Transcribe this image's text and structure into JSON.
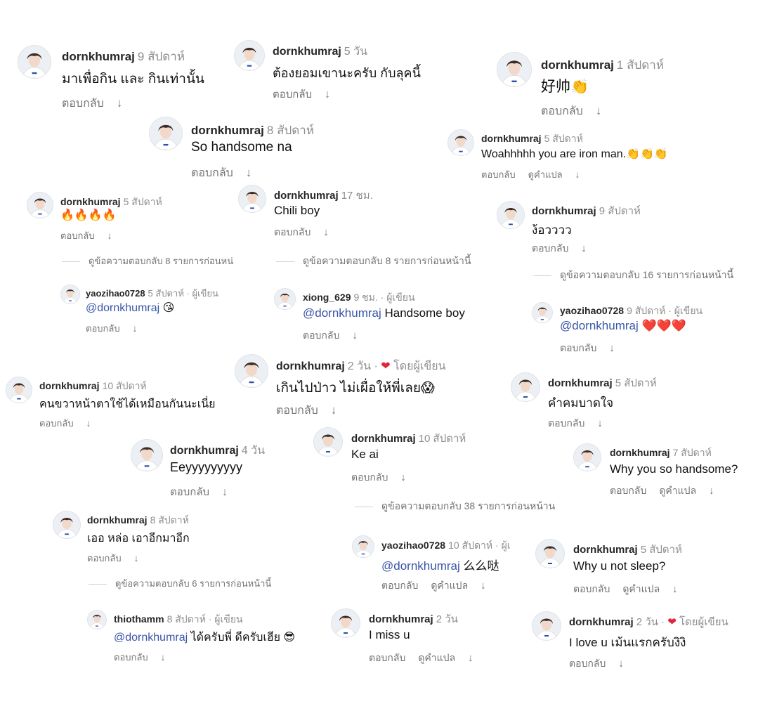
{
  "reply_label": "ตอบกลับ",
  "translate_label": "ดูคำแปล",
  "comments": [
    {
      "user": "dornkhumraj",
      "time": "9 สัปดาห์",
      "text": "มาเพื่อกิน และ กินเท่านั้น"
    },
    {
      "user": "dornkhumraj",
      "time": "5 วัน",
      "text": "ต้องยอมเขานะครับ กับลุคนี้"
    },
    {
      "user": "dornkhumraj",
      "time": "1 สัปดาห์",
      "text": "好帅👏"
    },
    {
      "user": "dornkhumraj",
      "time": "8 สัปดาห์",
      "text": "So handsome na"
    },
    {
      "user": "dornkhumraj",
      "time": "5 สัปดาห์",
      "text": "Woahhhhh you are iron man.👏👏👏"
    },
    {
      "user": "dornkhumraj",
      "time": "5 สัปดาห์",
      "text": "🔥🔥🔥🔥"
    },
    {
      "user": "dornkhumraj",
      "time": "17 ชม.",
      "text": "Chili boy"
    },
    {
      "user": "dornkhumraj",
      "time": "9 สัปดาห์",
      "text": "ง้อวววว"
    },
    {
      "user": "yaozihao0728",
      "time": "5 สัปดาห์ · ผู้เขียน",
      "mention": "@dornkhumraj",
      "text": " 😘"
    },
    {
      "user": "xiong_629",
      "time": "9 ชม. · ผู้เขียน",
      "mention": "@dornkhumraj",
      "text": " Handsome boy"
    },
    {
      "user": "yaozihao0728",
      "time": "9 สัปดาห์ · ผู้เขียน",
      "mention": "@dornkhumraj",
      "text": " ❤️❤️❤️"
    },
    {
      "user": "dornkhumraj",
      "time": "2 วัน ·",
      "heart": "❤",
      "suffix": "โดยผู้เขียน",
      "text": "เกินไปป่าว ไม่เผื่อให้พี่เลย😱"
    },
    {
      "user": "dornkhumraj",
      "time": "10 สัปดาห์",
      "text": "คนขวาหน้าตาใช้ได้เหมือนกันนะเนี่ย"
    },
    {
      "user": "dornkhumraj",
      "time": "5 สัปดาห์",
      "text": "คำคมบาดใจ"
    },
    {
      "user": "dornkhumraj",
      "time": "4 วัน",
      "text": "Eeyyyyyyyyy"
    },
    {
      "user": "dornkhumraj",
      "time": "10 สัปดาห์",
      "text": "Ke ai"
    },
    {
      "user": "dornkhumraj",
      "time": "7 สัปดาห์",
      "text": "Why you so handsome?"
    },
    {
      "user": "dornkhumraj",
      "time": "8 สัปดาห์",
      "text": "เออ หล่อ เอาอีกมาอีก"
    },
    {
      "user": "yaozihao0728",
      "time": "10 สัปดาห์ · ผู้เ",
      "mention": "@dornkhumraj",
      "text": " 么么哒"
    },
    {
      "user": "dornkhumraj",
      "time": "5 สัปดาห์",
      "text": "Why u not sleep?"
    },
    {
      "user": "thiothamm",
      "time": "8 สัปดาห์ · ผู้เขียน",
      "mention": "@dornkhumraj",
      "text": " ได้ครับพี่ ดีครับเฮีย 😎"
    },
    {
      "user": "dornkhumraj",
      "time": "2 วัน",
      "text": "I miss u"
    },
    {
      "user": "dornkhumraj",
      "time": "2 วัน ·",
      "heart": "❤",
      "suffix": "โดยผู้เขียน",
      "text": "I love u เม้นแรกครับงิงิ"
    }
  ],
  "view_replies": [
    "ดูข้อความตอบกลับ 8 รายการก่อนหน่",
    "ดูข้อความตอบกลับ 8 รายการก่อนหน้านี้",
    "ดูข้อความตอบกลับ 16 รายการก่อนหน้านี้",
    "ดูข้อความตอบกลับ 38 รายการก่อนหน้าน",
    "ดูข้อความตอบกลับ 6 รายการก่อนหน้านี้"
  ]
}
